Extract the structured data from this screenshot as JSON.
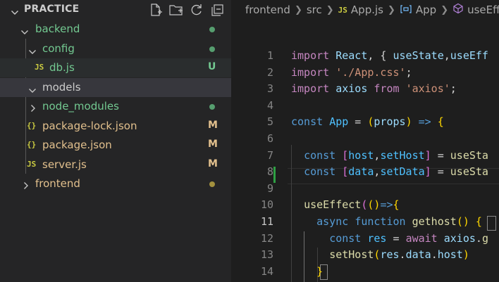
{
  "explorer": {
    "title": "PRACTICE",
    "actions": [
      {
        "name": "new-file-icon"
      },
      {
        "name": "new-folder-icon"
      },
      {
        "name": "refresh-icon"
      },
      {
        "name": "collapse-all-icon"
      }
    ],
    "tree": [
      {
        "label": "backend",
        "kind": "folder",
        "open": true,
        "status": "dot",
        "color": "#73c991"
      },
      {
        "label": "config",
        "kind": "folder",
        "open": true,
        "status": "dot",
        "color": "#73c991"
      },
      {
        "label": "db.js",
        "kind": "js",
        "icon_text": "JS",
        "status": "U",
        "color": "#73c991"
      },
      {
        "label": "models",
        "kind": "folder",
        "open": true,
        "status": "",
        "color": "#cccccc"
      },
      {
        "label": "node_modules",
        "kind": "folder",
        "open": false,
        "status": "dot",
        "color": "#73c991"
      },
      {
        "label": "package-lock.json",
        "kind": "json",
        "icon_text": "{}",
        "status": "M",
        "color": "#e2c08d"
      },
      {
        "label": "package.json",
        "kind": "json",
        "icon_text": "{}",
        "status": "M",
        "color": "#e2c08d"
      },
      {
        "label": "server.js",
        "kind": "js",
        "icon_text": "JS",
        "status": "M",
        "color": "#e2c08d"
      },
      {
        "label": "frontend",
        "kind": "folder",
        "open": false,
        "status": "dot",
        "color": "#e2c08d"
      }
    ]
  },
  "breadcrumb": {
    "items": [
      "frontend",
      "src",
      "App.js",
      "App",
      "useEffe"
    ],
    "js_icon": "JS"
  },
  "code": {
    "lines": [
      {
        "n": "1",
        "t": [
          [
            "k1",
            "import "
          ],
          [
            "v",
            "React"
          ],
          [
            "p",
            ", { "
          ],
          [
            "v",
            "useState"
          ],
          [
            "p",
            ","
          ],
          [
            "v",
            "useEff"
          ]
        ]
      },
      {
        "n": "2",
        "t": [
          [
            "k1",
            "import "
          ],
          [
            "s",
            "'./App.css'"
          ],
          [
            "p",
            ";"
          ]
        ]
      },
      {
        "n": "3",
        "t": [
          [
            "k1",
            "import "
          ],
          [
            "v",
            "axios "
          ],
          [
            "k1",
            "from "
          ],
          [
            "s",
            "'axios'"
          ],
          [
            "p",
            ";"
          ]
        ]
      },
      {
        "n": "4",
        "t": []
      },
      {
        "n": "5",
        "t": [
          [
            "k2",
            "const "
          ],
          [
            "c",
            "App"
          ],
          [
            "p",
            " = "
          ],
          [
            "b1",
            "("
          ],
          [
            "v",
            "props"
          ],
          [
            "b1",
            ")"
          ],
          [
            "p",
            " "
          ],
          [
            "k2",
            "=>"
          ],
          [
            "p",
            " "
          ],
          [
            "b1",
            "{"
          ]
        ]
      },
      {
        "n": "6",
        "t": []
      },
      {
        "n": "7",
        "t": [
          [
            "p",
            "  "
          ],
          [
            "k2",
            "const "
          ],
          [
            "b2",
            "["
          ],
          [
            "c",
            "host"
          ],
          [
            "p",
            ","
          ],
          [
            "c",
            "setHost"
          ],
          [
            "b2",
            "]"
          ],
          [
            "p",
            " = "
          ],
          [
            "f",
            "useSta"
          ]
        ]
      },
      {
        "n": "8",
        "t": [
          [
            "p",
            "  "
          ],
          [
            "k2",
            "const "
          ],
          [
            "b2",
            "["
          ],
          [
            "c",
            "data"
          ],
          [
            "p",
            ","
          ],
          [
            "c",
            "setData"
          ],
          [
            "b2",
            "]"
          ],
          [
            "p",
            " = "
          ],
          [
            "f",
            "useSta"
          ]
        ]
      },
      {
        "n": "9",
        "t": []
      },
      {
        "n": "10",
        "t": [
          [
            "p",
            "  "
          ],
          [
            "f",
            "useEffect"
          ],
          [
            "b2",
            "("
          ],
          [
            "b1",
            "()"
          ],
          [
            "k2",
            "=>"
          ],
          [
            "b1",
            "{"
          ]
        ]
      },
      {
        "n": "11",
        "t": [
          [
            "p",
            "    "
          ],
          [
            "k2",
            "async "
          ],
          [
            "k2",
            "function "
          ],
          [
            "f",
            "gethost"
          ],
          [
            "b1",
            "()"
          ],
          [
            "p",
            " "
          ],
          [
            "b1",
            "{"
          ]
        ]
      },
      {
        "n": "12",
        "t": [
          [
            "p",
            "      "
          ],
          [
            "k2",
            "const "
          ],
          [
            "c",
            "res"
          ],
          [
            "p",
            " = "
          ],
          [
            "k1",
            "await "
          ],
          [
            "v",
            "axios"
          ],
          [
            "p",
            "."
          ],
          [
            "f",
            "g"
          ]
        ]
      },
      {
        "n": "13",
        "t": [
          [
            "p",
            "      "
          ],
          [
            "f",
            "setHost"
          ],
          [
            "b1",
            "("
          ],
          [
            "v",
            "res"
          ],
          [
            "p",
            "."
          ],
          [
            "v",
            "data"
          ],
          [
            "p",
            "."
          ],
          [
            "v",
            "host"
          ],
          [
            "b1",
            ")"
          ]
        ]
      },
      {
        "n": "14",
        "t": [
          [
            "p",
            "    "
          ],
          [
            "b1",
            "}"
          ]
        ]
      }
    ],
    "current_line": "11"
  }
}
